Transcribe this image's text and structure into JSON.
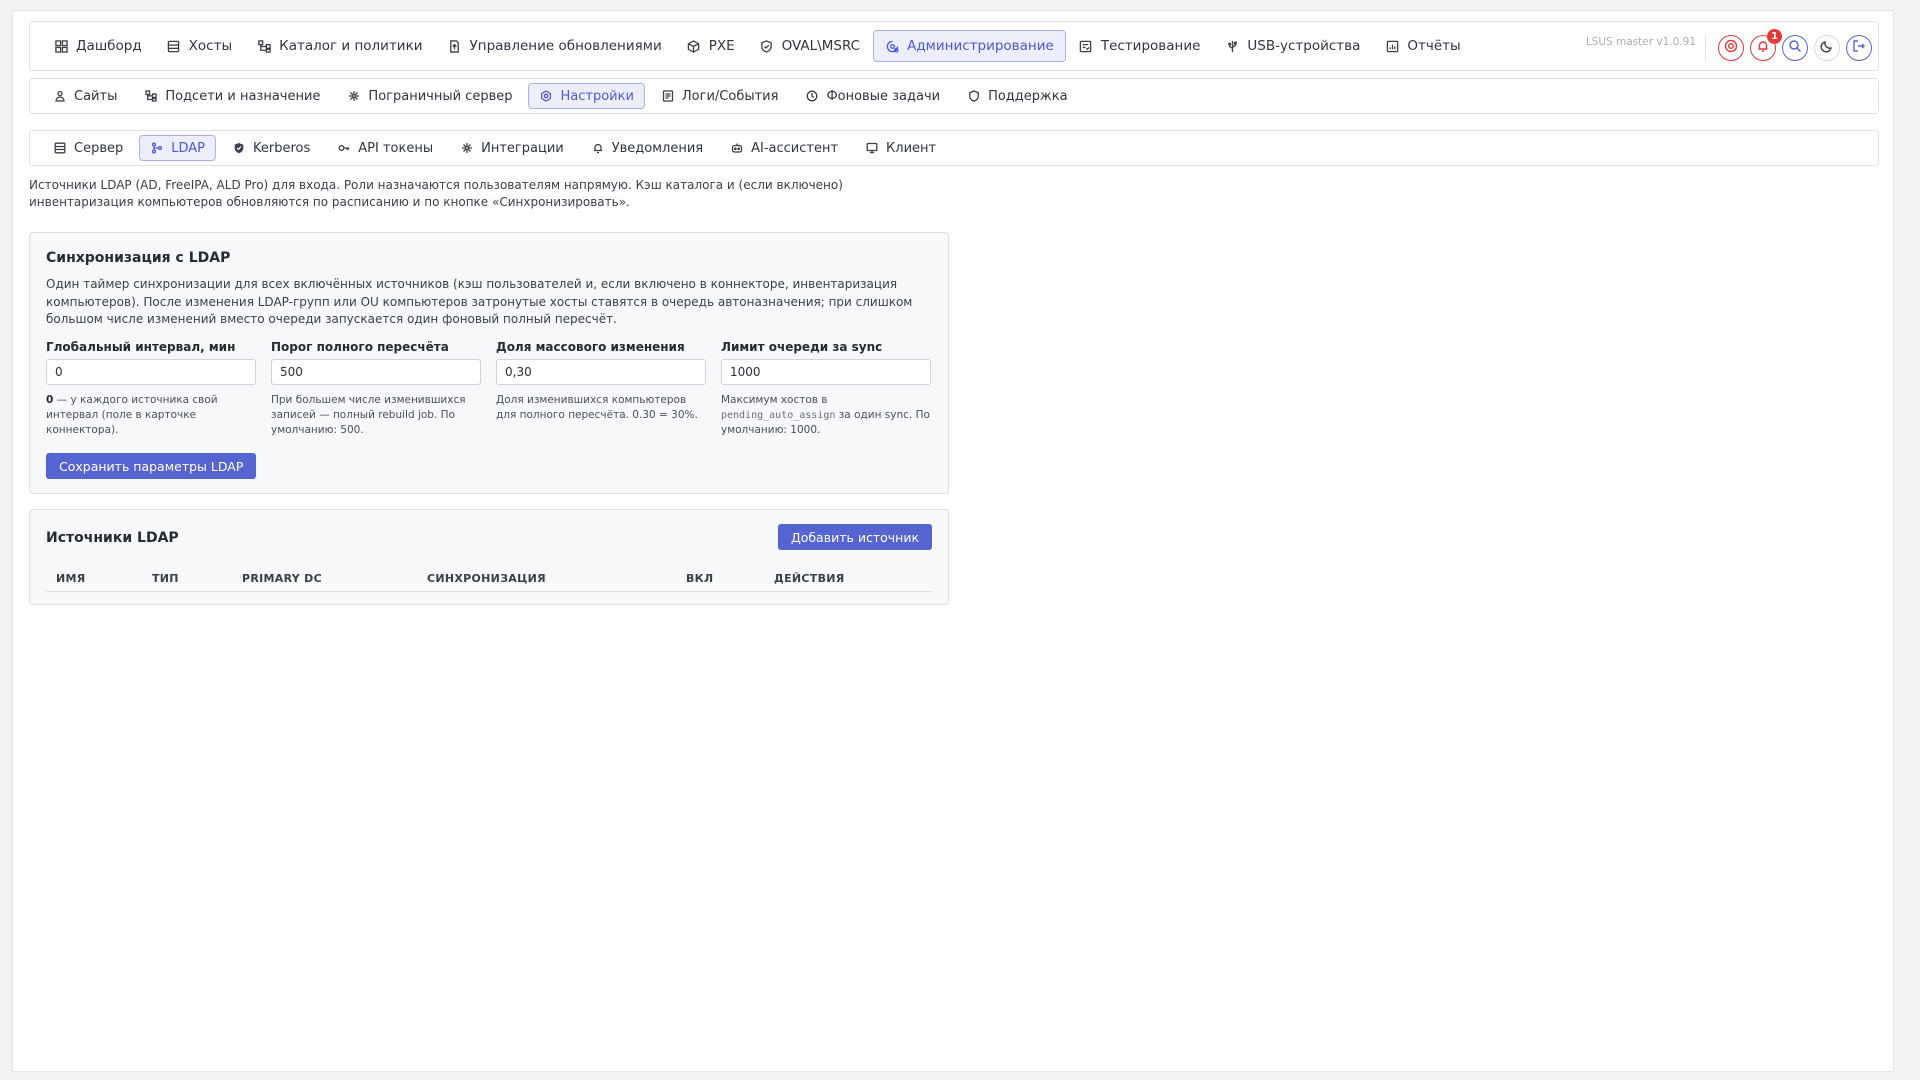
{
  "nav": {
    "items": [
      {
        "label": "Дашборд",
        "icon": "dashboard-icon"
      },
      {
        "label": "Хосты",
        "icon": "server-icon"
      },
      {
        "label": "Каталог и политики",
        "icon": "tree-icon"
      },
      {
        "label": "Управление обновлениями",
        "icon": "file-update-icon"
      },
      {
        "label": "PXE",
        "icon": "box-icon"
      },
      {
        "label": "OVAL\\MSRC",
        "icon": "shield-icon"
      },
      {
        "label": "Администрирование",
        "icon": "admin-gear-icon"
      },
      {
        "label": "Тестирование",
        "icon": "test-icon"
      },
      {
        "label": "USB-устройства",
        "icon": "usb-icon"
      },
      {
        "label": "Отчёты",
        "icon": "report-icon"
      }
    ],
    "active_index": 6,
    "version": "LSUS master v1.0.91",
    "notifications_count": "1"
  },
  "admin_tabs": {
    "items": [
      {
        "label": "Сайты",
        "icon": "sites-icon"
      },
      {
        "label": "Подсети и назначение",
        "icon": "subnet-icon"
      },
      {
        "label": "Пограничный сервер",
        "icon": "edge-server-icon"
      },
      {
        "label": "Настройки",
        "icon": "settings-icon"
      },
      {
        "label": "Логи/События",
        "icon": "logs-icon"
      },
      {
        "label": "Фоновые задачи",
        "icon": "clock-icon"
      },
      {
        "label": "Поддержка",
        "icon": "support-icon"
      }
    ],
    "active_index": 3
  },
  "settings_tabs": {
    "items": [
      {
        "label": "Сервер",
        "icon": "server-icon"
      },
      {
        "label": "LDAP",
        "icon": "ldap-icon"
      },
      {
        "label": "Kerberos",
        "icon": "kerberos-icon"
      },
      {
        "label": "API токены",
        "icon": "key-icon"
      },
      {
        "label": "Интеграции",
        "icon": "integrations-icon"
      },
      {
        "label": "Уведомления",
        "icon": "bell-icon"
      },
      {
        "label": "AI-ассистент",
        "icon": "robot-icon"
      },
      {
        "label": "Клиент",
        "icon": "client-icon"
      }
    ],
    "active_index": 1
  },
  "intro": "Источники LDAP (AD, FreeIPA, ALD Pro) для входа. Роли назначаются пользователям напрямую. Кэш каталога и (если включено) инвентаризация компьютеров обновляются по расписанию и по кнопке «Синхронизировать».",
  "sync_card": {
    "title": "Синхронизация с LDAP",
    "description": "Один таймер синхронизации для всех включённых источников (кэш пользователей и, если включено в коннекторе, инвентаризация компьютеров). После изменения LDAP-групп или OU компьютеров затронутые хосты ставятся в очередь автоназначения; при слишком большом числе изменений вместо очереди запускается один фоновый полный пересчёт.",
    "fields": {
      "interval": {
        "label": "Глобальный интервал, мин",
        "value": "0",
        "help_bold": "0",
        "help": " — у каждого источника свой интервал (поле в карточке коннектора)."
      },
      "threshold": {
        "label": "Порог полного пересчёта",
        "value": "500",
        "help": "При большем числе изменившихся записей — полный rebuild job. По умолчанию: 500."
      },
      "fraction": {
        "label": "Доля массового изменения",
        "value": "0,30",
        "help": "Доля изменившихся компьютеров для полного пересчёта. 0.30 = 30%."
      },
      "limit": {
        "label": "Лимит очереди за sync",
        "value": "1000",
        "help_pre": "Максимум хостов в ",
        "help_code": "pending_auto_assign",
        "help_post": " за один sync. По умолчанию: 1000."
      }
    },
    "save_label": "Сохранить параметры LDAP"
  },
  "sources_card": {
    "title": "Источники LDAP",
    "add_label": "Добавить источник",
    "columns": [
      "ИМЯ",
      "ТИП",
      "PRIMARY DC",
      "СИНХРОНИЗАЦИЯ",
      "ВКЛ",
      "ДЕЙСТВИЯ"
    ]
  }
}
